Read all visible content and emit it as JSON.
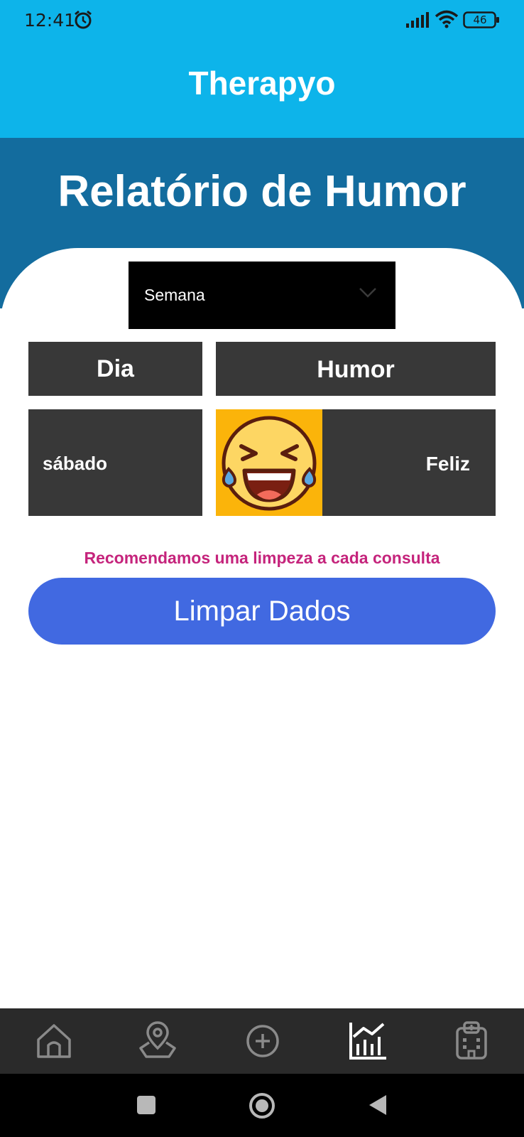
{
  "status_bar": {
    "time": "12:41",
    "battery": "46",
    "icons": [
      "alarm-icon",
      "signal-icon",
      "wifi-icon",
      "battery-icon"
    ]
  },
  "header": {
    "title": "Therapyo"
  },
  "hero": {
    "title": "Relatório de Humor"
  },
  "period_select": {
    "value": "Semana"
  },
  "table": {
    "columns": [
      "Dia",
      "Humor"
    ],
    "rows": [
      {
        "day": "sábado",
        "mood": "Feliz",
        "mood_icon": "laughing-face-icon"
      }
    ]
  },
  "recommendation": "Recomendamos uma limpeza a cada consulta",
  "clear_button": "Limpar Dados",
  "bottom_nav": {
    "items": [
      "home-icon",
      "map-location-icon",
      "add-circle-icon",
      "chart-icon",
      "hospital-icon"
    ],
    "active": "chart-icon"
  },
  "colors": {
    "header": "#0db4ea",
    "hero": "#136c9e",
    "cell": "#383838",
    "button": "#4169e1",
    "recommendation": "#c5247c",
    "emoji_bg": "#fbb40a"
  }
}
